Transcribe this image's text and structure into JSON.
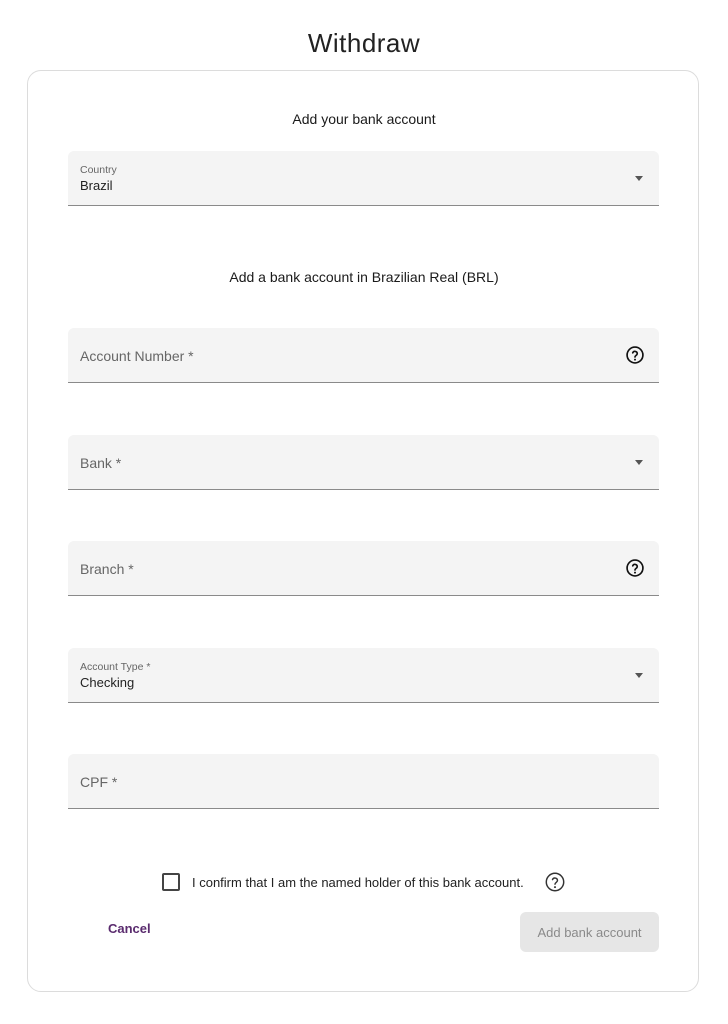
{
  "page": {
    "title": "Withdraw"
  },
  "card": {
    "heading": "Add your bank account",
    "subheading": "Add a bank account in Brazilian Real (BRL)"
  },
  "fields": {
    "country": {
      "label": "Country",
      "value": "Brazil"
    },
    "account_number": {
      "placeholder": "Account Number *"
    },
    "bank": {
      "placeholder": "Bank *"
    },
    "branch": {
      "placeholder": "Branch *"
    },
    "account_type": {
      "label": "Account Type *",
      "value": "Checking"
    },
    "cpf": {
      "placeholder": "CPF *"
    }
  },
  "confirm": {
    "checked": false,
    "label": "I confirm that I am the named holder of this bank account."
  },
  "actions": {
    "cancel_label": "Cancel",
    "submit_label": "Add bank account"
  },
  "icons": {
    "dropdown": "chevron-down-icon",
    "help": "help-circle-icon",
    "checkbox": "checkbox-unchecked-icon"
  },
  "colors": {
    "field_bg": "#f4f4f4",
    "cancel_text": "#5a2b6e",
    "disabled_button_bg": "#e6e6e6",
    "disabled_button_text": "#8a8a8a"
  }
}
